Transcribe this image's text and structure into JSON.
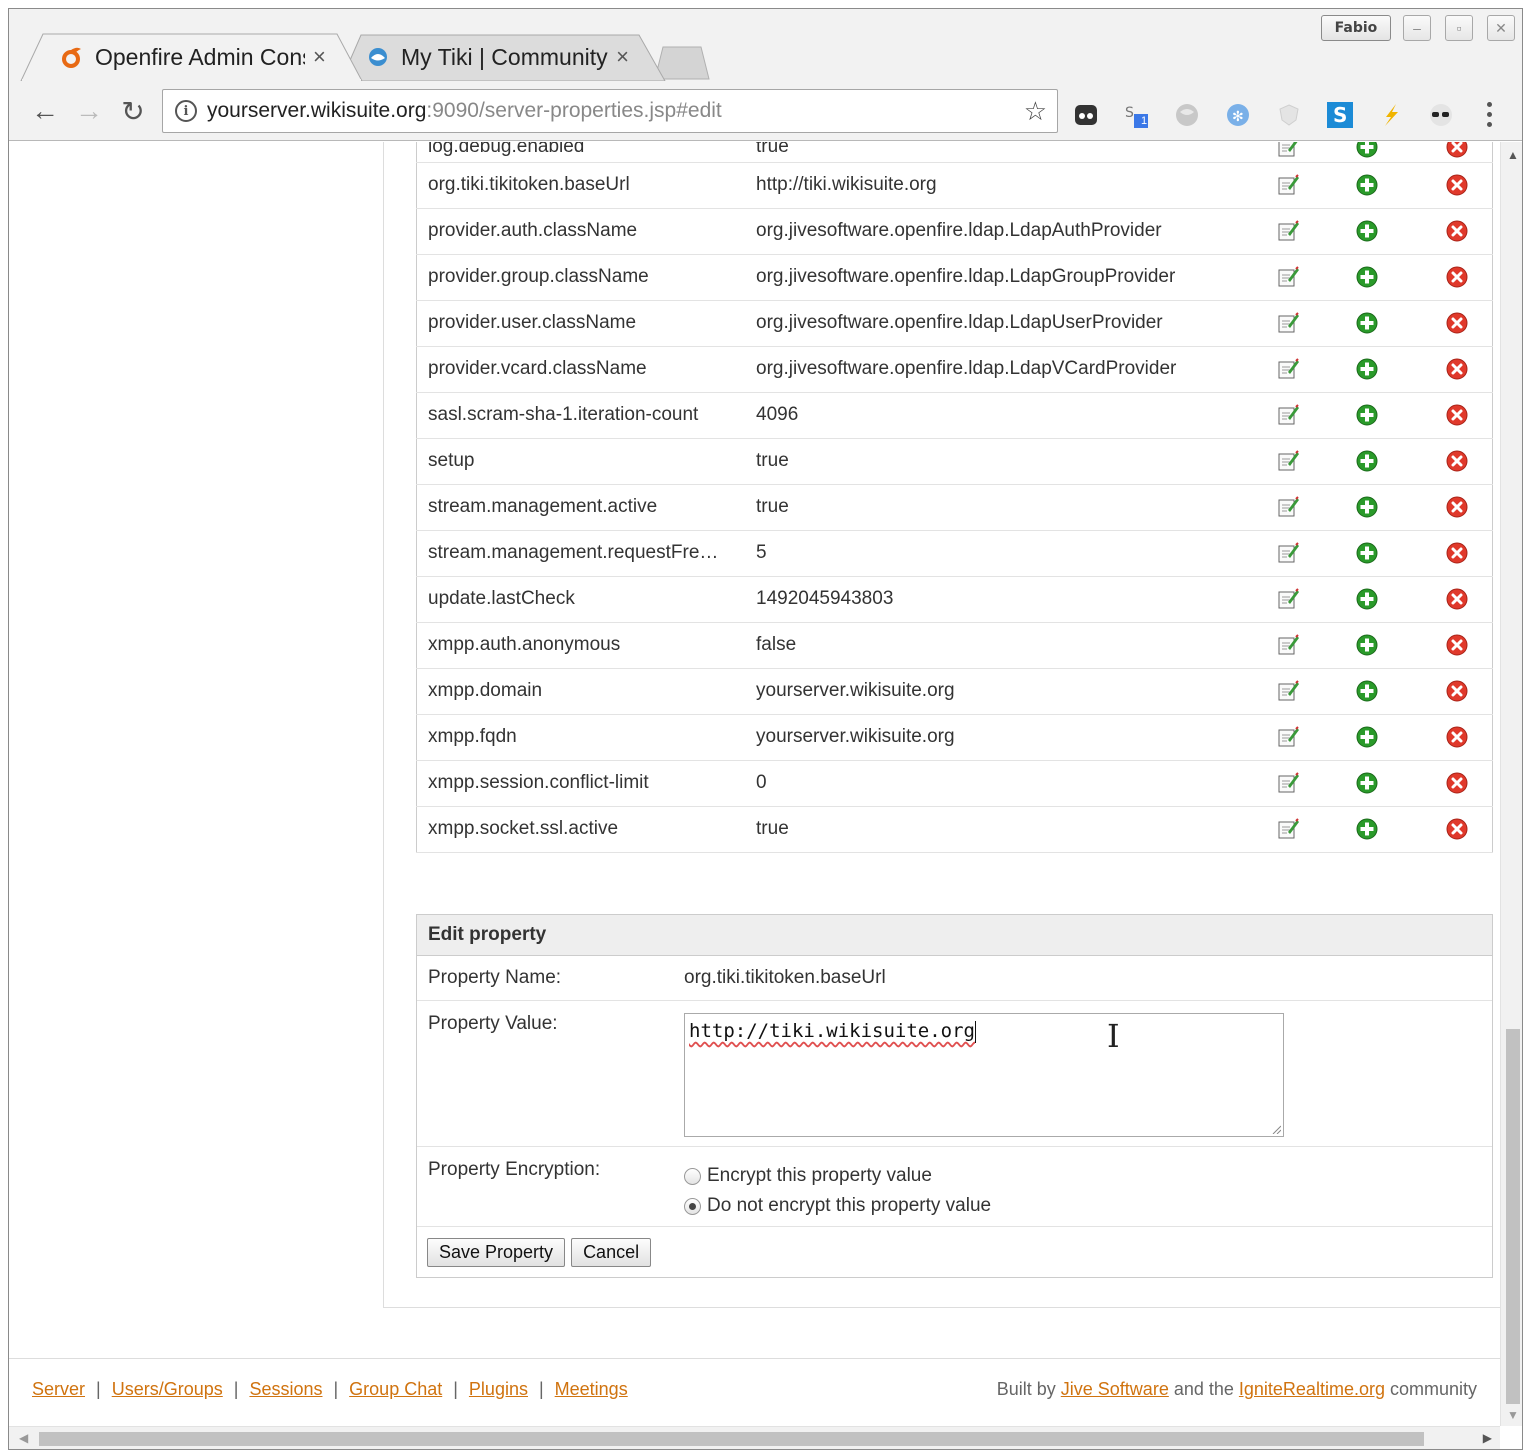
{
  "browser": {
    "profile_name": "Fabio",
    "tabs": [
      {
        "title": "Openfire Admin Console",
        "active": true,
        "icon": "openfire-flame-icon"
      },
      {
        "title": "My Tiki | Community",
        "active": false,
        "icon": "tiki-icon"
      }
    ],
    "address_host": "yourserver.wikisuite.org",
    "address_rest": ":9090/server-properties.jsp#edit",
    "extension_badge": "1"
  },
  "properties": [
    {
      "name": "log.debug.enabled",
      "value": "true"
    },
    {
      "name": "org.tiki.tikitoken.baseUrl",
      "value": "http://tiki.wikisuite.org"
    },
    {
      "name": "provider.auth.className",
      "value": "org.jivesoftware.openfire.ldap.LdapAuthProvider"
    },
    {
      "name": "provider.group.className",
      "value": "org.jivesoftware.openfire.ldap.LdapGroupProvider"
    },
    {
      "name": "provider.user.className",
      "value": "org.jivesoftware.openfire.ldap.LdapUserProvider"
    },
    {
      "name": "provider.vcard.className",
      "value": "org.jivesoftware.openfire.ldap.LdapVCardProvider"
    },
    {
      "name": "sasl.scram-sha-1.iteration-count",
      "value": "4096"
    },
    {
      "name": "setup",
      "value": "true"
    },
    {
      "name": "stream.management.active",
      "value": "true"
    },
    {
      "name": "stream.management.requestFre…",
      "value": "5"
    },
    {
      "name": "update.lastCheck",
      "value": "1492045943803"
    },
    {
      "name": "xmpp.auth.anonymous",
      "value": "false"
    },
    {
      "name": "xmpp.domain",
      "value": "yourserver.wikisuite.org"
    },
    {
      "name": "xmpp.fqdn",
      "value": "yourserver.wikisuite.org"
    },
    {
      "name": "xmpp.session.conflict-limit",
      "value": "0"
    },
    {
      "name": "xmpp.socket.ssl.active",
      "value": "true"
    }
  ],
  "edit": {
    "heading": "Edit property",
    "name_label": "Property Name:",
    "name_value": "org.tiki.tikitoken.baseUrl",
    "value_label": "Property Value:",
    "value_text": "http://tiki.wikisuite.org",
    "encryption_label": "Property Encryption:",
    "encrypt_option": "Encrypt this property value",
    "no_encrypt_option": "Do not encrypt this property value",
    "selected_option": "no_encrypt",
    "save_label": "Save Property",
    "cancel_label": "Cancel"
  },
  "footer": {
    "nav": [
      "Server",
      "Users/Groups",
      "Sessions",
      "Group Chat",
      "Plugins",
      "Meetings"
    ],
    "credit_prefix": "Built by ",
    "credit_link1": "Jive Software",
    "credit_middle": " and the ",
    "credit_link2": "IgniteRealtime.org",
    "credit_suffix": " community"
  },
  "colors": {
    "link": "#d0730f",
    "add_icon": "#2a9a2a",
    "delete_icon": "#e0392b"
  }
}
